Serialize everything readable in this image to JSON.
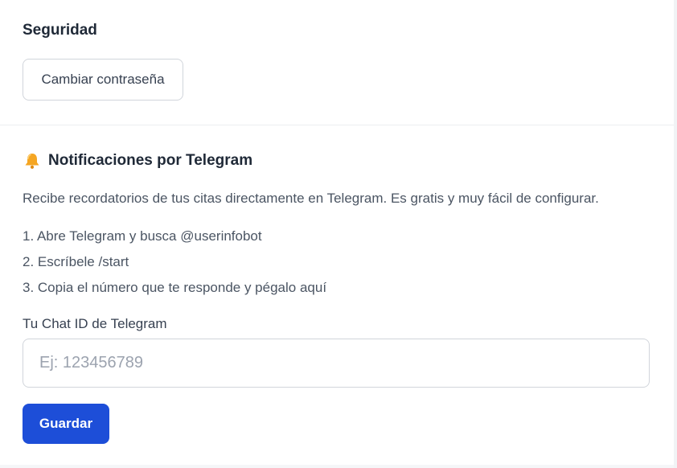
{
  "security": {
    "title": "Seguridad",
    "change_password_label": "Cambiar contraseña"
  },
  "telegram": {
    "icon": "bell-icon",
    "title": "Notificaciones por Telegram",
    "description": "Recibe recordatorios de tus citas directamente en Telegram. Es gratis y muy fácil de configurar.",
    "steps": [
      "1. Abre Telegram y busca @userinfobot",
      "2. Escríbele /start",
      "3. Copia el número que te responde y pégalo aquí"
    ],
    "chat_id_label": "Tu Chat ID de Telegram",
    "chat_id_placeholder": "Ej: 123456789",
    "chat_id_value": "",
    "save_label": "Guardar"
  },
  "colors": {
    "primary": "#1d4ed8",
    "bell": "#f5a623"
  }
}
